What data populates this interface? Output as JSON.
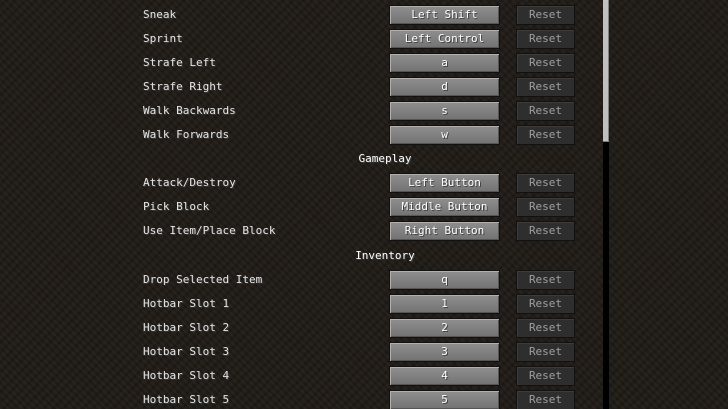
{
  "reset_label": "Reset",
  "movement": {
    "sneak": {
      "label": "Sneak",
      "key": "Left Shift"
    },
    "sprint": {
      "label": "Sprint",
      "key": "Left Control"
    },
    "strafe_left": {
      "label": "Strafe Left",
      "key": "a"
    },
    "strafe_right": {
      "label": "Strafe Right",
      "key": "d"
    },
    "walk_backwards": {
      "label": "Walk Backwards",
      "key": "s"
    },
    "walk_forwards": {
      "label": "Walk Forwards",
      "key": "w"
    }
  },
  "gameplay": {
    "title": "Gameplay",
    "attack": {
      "label": "Attack/Destroy",
      "key": "Left Button"
    },
    "pick_block": {
      "label": "Pick Block",
      "key": "Middle Button"
    },
    "use_item": {
      "label": "Use Item/Place Block",
      "key": "Right Button"
    }
  },
  "inventory": {
    "title": "Inventory",
    "drop": {
      "label": "Drop Selected Item",
      "key": "q"
    },
    "hotbar1": {
      "label": "Hotbar Slot 1",
      "key": "1"
    },
    "hotbar2": {
      "label": "Hotbar Slot 2",
      "key": "2"
    },
    "hotbar3": {
      "label": "Hotbar Slot 3",
      "key": "3"
    },
    "hotbar4": {
      "label": "Hotbar Slot 4",
      "key": "4"
    },
    "hotbar5": {
      "label": "Hotbar Slot 5",
      "key": "5"
    }
  },
  "colors": {
    "background": "#1f1a15",
    "button": "#7f7f7f",
    "reset_disabled": "#2e2e2e",
    "label_text": "#e6e6e6"
  }
}
